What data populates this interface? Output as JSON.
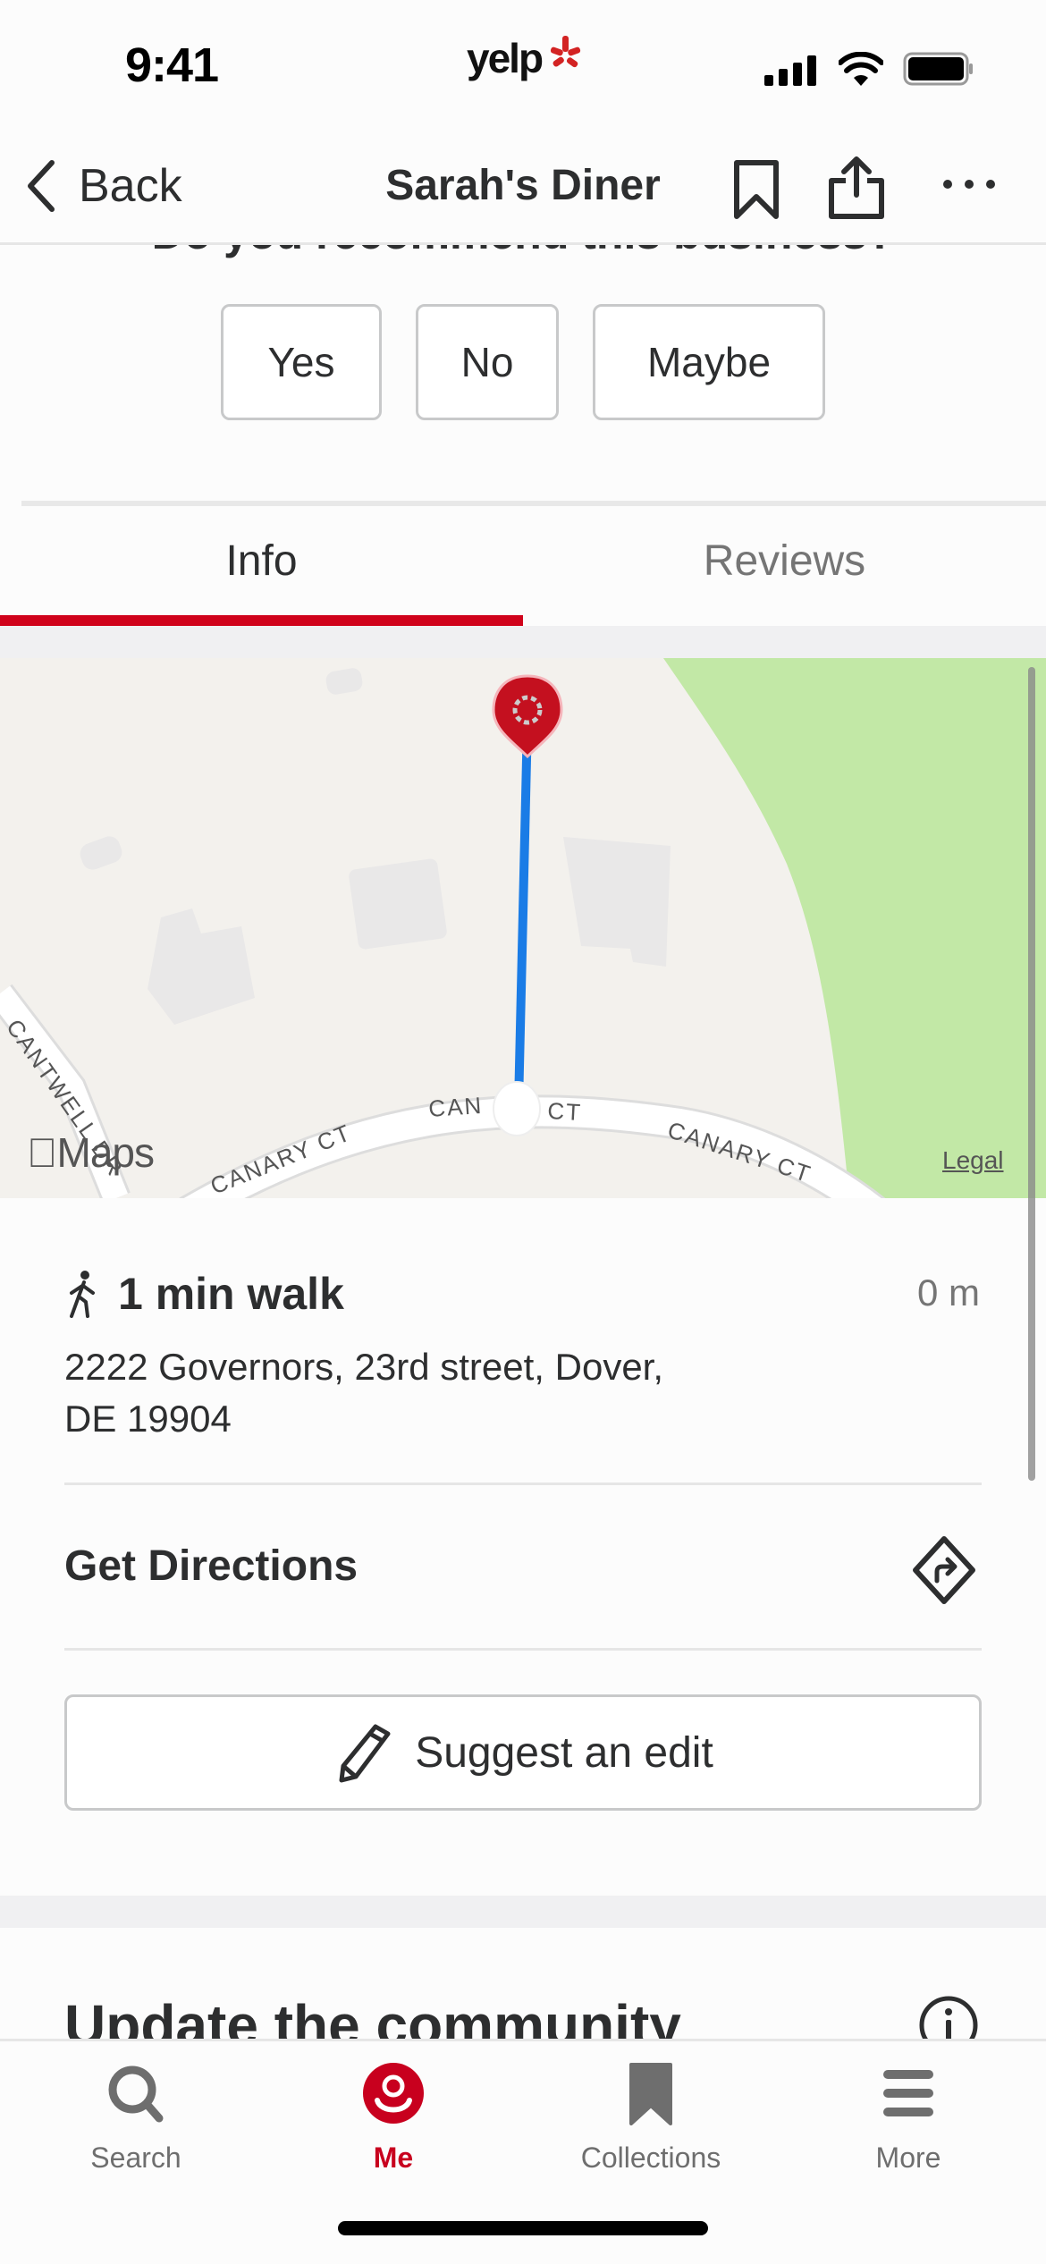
{
  "status_bar": {
    "time": "9:41",
    "app_logo": "yelp",
    "icons": [
      "cellular-signal-icon",
      "wifi-icon",
      "battery-icon"
    ]
  },
  "nav": {
    "back_label": "Back",
    "title": "Sarah's Diner",
    "actions": [
      "bookmark-icon",
      "share-icon",
      "more-icon"
    ]
  },
  "recommend": {
    "question": "Do you recommend this business?",
    "options": [
      "Yes",
      "No",
      "Maybe"
    ]
  },
  "tabs": [
    {
      "label": "Info",
      "active": true
    },
    {
      "label": "Reviews",
      "active": false
    }
  ],
  "map": {
    "streets": [
      "CANARY CT",
      "CANARY CT",
      "CANARY CT",
      "CANTWELL DR"
    ],
    "attribution": "Maps",
    "legal": "Legal",
    "pin": "yelp-pin-icon",
    "route_color": "#1a7ce6",
    "park_color": "#c2e8a6"
  },
  "location": {
    "walk_time": "1 min walk",
    "distance": "0 m",
    "address_line1": "2222 Governors, 23rd street, Dover,",
    "address_line2": "DE 19904"
  },
  "directions": {
    "label": "Get Directions"
  },
  "suggest_edit": {
    "label": "Suggest an edit"
  },
  "community": {
    "heading": "Update the community"
  },
  "tab_bar": {
    "items": [
      {
        "label": "Search",
        "icon": "search-icon",
        "active": false
      },
      {
        "label": "Me",
        "icon": "profile-icon",
        "active": true
      },
      {
        "label": "Collections",
        "icon": "bookmark-icon",
        "active": false
      },
      {
        "label": "More",
        "icon": "menu-icon",
        "active": false
      }
    ]
  },
  "colors": {
    "brand_red": "#d0021b",
    "active_tab_red": "#c8001e",
    "text_primary": "#2d2e2f",
    "text_secondary": "#757575"
  }
}
